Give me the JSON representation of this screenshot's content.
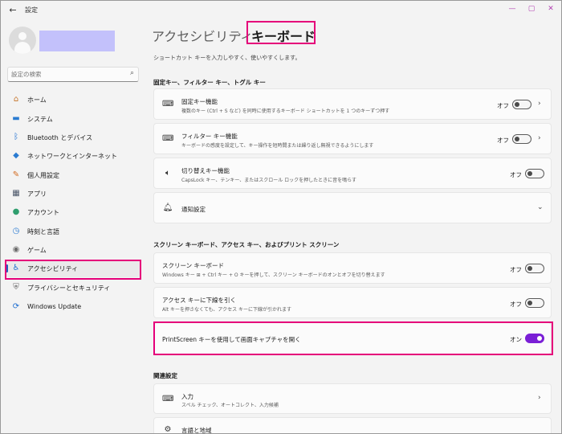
{
  "window": {
    "back_icon": "←",
    "app_title": "設定",
    "minimize": "—",
    "maximize": "▢",
    "close": "✕"
  },
  "sidebar": {
    "search_placeholder": "設定の検索",
    "items": [
      {
        "label": "ホーム",
        "icon": "home-icon",
        "glyph": "⌂",
        "color": "#c6752b"
      },
      {
        "label": "システム",
        "icon": "system-icon",
        "glyph": "▬",
        "color": "#2a7bd1"
      },
      {
        "label": "Bluetooth とデバイス",
        "icon": "bluetooth-icon",
        "glyph": "ᛒ",
        "color": "#1f6fd1"
      },
      {
        "label": "ネットワークとインターネット",
        "icon": "network-icon",
        "glyph": "◆",
        "color": "#2a7bd1"
      },
      {
        "label": "個人用設定",
        "icon": "personalization-icon",
        "glyph": "✎",
        "color": "#d2691e"
      },
      {
        "label": "アプリ",
        "icon": "apps-icon",
        "glyph": "▦",
        "color": "#4a5568"
      },
      {
        "label": "アカウント",
        "icon": "account-icon",
        "glyph": "●",
        "color": "#2f9e6e"
      },
      {
        "label": "時刻と言語",
        "icon": "time-language-icon",
        "glyph": "◷",
        "color": "#2a7bd1"
      },
      {
        "label": "ゲーム",
        "icon": "gaming-icon",
        "glyph": "◉",
        "color": "#6b6b6b"
      },
      {
        "label": "アクセシビリティ",
        "icon": "accessibility-icon",
        "glyph": "♿",
        "color": "#1f6fd1"
      },
      {
        "label": "プライバシーとセキュリティ",
        "icon": "privacy-shield-icon",
        "glyph": "⛨",
        "color": "#6b6b6b"
      },
      {
        "label": "Windows Update",
        "icon": "windows-update-icon",
        "glyph": "⟳",
        "color": "#1f6fd1"
      }
    ],
    "active_index": 9
  },
  "main": {
    "breadcrumb_parent": "アクセシビリティ",
    "breadcrumb_sep": "›",
    "title": "キーボード",
    "description": "ショートカット キーを入力しやすく、使いやすくします。",
    "section1": "固定キー、フィルター キー、トグル キー",
    "sticky": {
      "title": "固定キー機能",
      "desc": "複数のキー (Ctrl + S など) を同時に使用するキーボード ショートカットを 1 つのキーずつ押す",
      "state": "オフ",
      "on": false
    },
    "filter": {
      "title": "フィルター キー機能",
      "desc": "キーボードの感度を設定して、キー操作を短時間または繰り返し無視できるようにします",
      "state": "オフ",
      "on": false
    },
    "toggle_keys": {
      "title": "切り替えキー機能",
      "desc": "CapsLock キー、テンキー、またはスクロール ロックを押したときに音を鳴らす",
      "state": "オフ",
      "on": false
    },
    "notifications": {
      "title": "通知設定"
    },
    "section2": "スクリーン キーボード、アクセス キー、およびプリント スクリーン",
    "onscreen": {
      "title": "スクリーン キーボード",
      "desc": "Windows キー ⊞ + Ctrl キー + O キーを押して、スクリーン キーボードのオンとオフを切り替えます",
      "state": "オフ",
      "on": false
    },
    "underline": {
      "title": "アクセス キーに下線を引く",
      "desc": "Alt キーを押さなくても、アクセス キーに下線が引かれます",
      "state": "オフ",
      "on": false
    },
    "printscreen": {
      "title": "PrintScreen キーを使用して画面キャプチャを開く",
      "state": "オン",
      "on": true
    },
    "section3": "関連設定",
    "input": {
      "title": "入力",
      "desc": "スペル チェック、オートコレクト、入力候補"
    },
    "language": {
      "title": "言語と地域"
    }
  },
  "colors": {
    "highlight": "#e5007a",
    "toggle_on": "#7a1fd6",
    "accent": "#1f5fbf"
  }
}
